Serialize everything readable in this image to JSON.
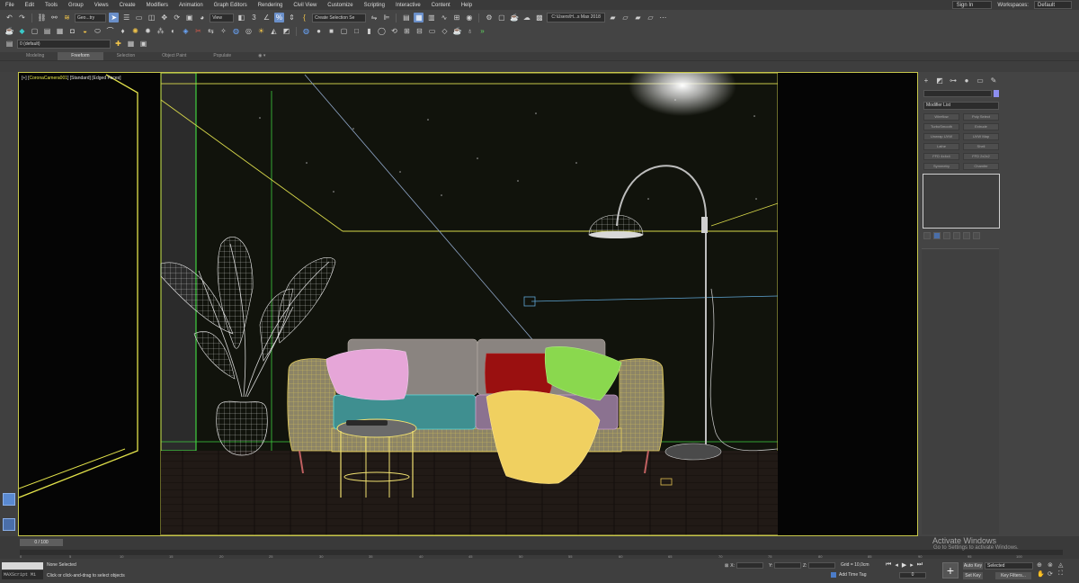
{
  "menubar": {
    "items": [
      "File",
      "Edit",
      "Tools",
      "Group",
      "Views",
      "Create",
      "Modifiers",
      "Animation",
      "Graph Editors",
      "Rendering",
      "Civil View",
      "Customize",
      "Scripting",
      "Interactive",
      "Content",
      "Help"
    ],
    "sign_in": "Sign In",
    "workspaces_label": "Workspaces:",
    "workspace_value": "Default"
  },
  "toolbar": {
    "filter_select": "Geo...try",
    "view_select": "View",
    "selection_set": "Create Selection Se",
    "project_path": "C:\\Users\\H...s Max 2018"
  },
  "layer_toolbar": {
    "layer_select": "0 (default)"
  },
  "ribbon": {
    "tabs": [
      "Modeling",
      "Freeform",
      "Selection",
      "Object Paint",
      "Populate"
    ],
    "active_tab": "Freeform"
  },
  "viewport": {
    "label_prefix": "[+] [",
    "camera": "CoronaCamera001",
    "label_suffix": "] [Standard] [Edged Faces]"
  },
  "command_panel": {
    "modifier_list": "Modifier List",
    "modifiers": [
      "Wireflow",
      "Poly Select",
      "TurboSmooth",
      "Extrude",
      "Unwrap UVW",
      "UVW Map",
      "Lathe",
      "Shell",
      "FFD 4x4x4",
      "FFD 2x2x2",
      "Symmetry",
      "Chamfer"
    ]
  },
  "timeline": {
    "frame_display": "0 / 100",
    "ticks": [
      "0",
      "5",
      "10",
      "15",
      "20",
      "25",
      "30",
      "35",
      "40",
      "45",
      "50",
      "55",
      "60",
      "65",
      "70",
      "75",
      "80",
      "85",
      "90",
      "95",
      "100"
    ]
  },
  "status": {
    "maxscript": "MAXScript Mi",
    "selection": "None Selected",
    "hint": "Click or click-and-drag to select objects",
    "x_label": "X:",
    "y_label": "Y:",
    "z_label": "Z:",
    "grid": "Grid = 10,0cm",
    "add_time_tag": "Add Time Tag",
    "current_frame": "0",
    "auto_key": "Auto Key",
    "set_key": "Set Key",
    "key_mode": "Selected",
    "key_filters": "Key Filters..."
  },
  "watermark": {
    "title": "Activate Windows",
    "subtitle": "Go to Settings to activate Windows."
  },
  "colors": {
    "viewport_border": "#c7c74a",
    "active_tool": "#6a8fc9",
    "sofa_wire": "#d8c55a",
    "pillow_pink": "#e6a6d8",
    "pillow_red": "#9a1010",
    "pillow_green": "#8ad84e",
    "throw_yellow": "#f0d060",
    "room_green": "#3fcf3f"
  }
}
